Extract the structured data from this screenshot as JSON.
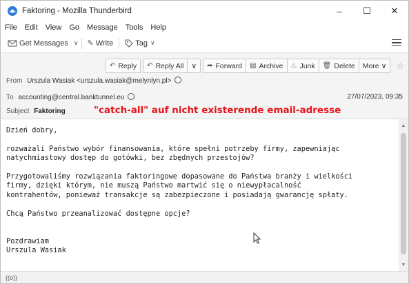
{
  "window": {
    "title": "Faktoring - Mozilla Thunderbird",
    "minimize": "–",
    "maximize": "☐",
    "close": "✕"
  },
  "menu": [
    "File",
    "Edit",
    "View",
    "Go",
    "Message",
    "Tools",
    "Help"
  ],
  "toolbar": {
    "get_messages": "Get Messages",
    "write": "Write",
    "tag": "Tag"
  },
  "actions": {
    "reply": "Reply",
    "reply_all": "Reply All",
    "forward": "Forward",
    "archive": "Archive",
    "junk": "Junk",
    "delete": "Delete",
    "more": "More"
  },
  "header": {
    "from_label": "From",
    "from_value": "Urszula Wasiak <urszula.wasiak@melynlyn.pl>",
    "to_label": "To",
    "to_value": "accounting@central.banktunnel.eu",
    "date": "27/07/2023, 09:35",
    "subject_label": "Subject",
    "subject_value": "Faktoring",
    "annotation": "\"catch-all\" auf nicht existerende email-adresse"
  },
  "body": {
    "text": "Dzień dobry,\n\nrozważali Państwo wybór finansowania, które spełni potrzeby firmy, zapewniając\nnatychmiastowy dostęp do gotówki, bez zbędnych przestojów?\n\nPrzygotowaliśmy rozwiązania faktoringowe dopasowane do Państwa branży i wielkości\nfirmy, dzięki którym, nie muszą Państwo martwić się o niewypłacalność\nkontrahentów, ponieważ transakcje są zabezpieczone i posiadają gwarancję spłaty.\n\nChcą Państwo przeanalizować dostępne opcje?\n\n\nPozdrawiam\nUrszula Wasiak"
  },
  "status": {
    "text": "((o))"
  },
  "colors": {
    "annotation": "#e8141a",
    "header_bg": "#f4f4f4"
  },
  "icons": {
    "app": "thunderbird-icon",
    "get_messages": "envelope-icon",
    "write": "pencil-icon",
    "tag": "tag-icon",
    "reply": "reply-icon",
    "reply_all": "reply-all-icon",
    "forward": "forward-icon",
    "archive": "archive-icon",
    "junk": "junk-icon",
    "delete": "trash-icon",
    "star": "star-icon",
    "menu": "hamburger-icon"
  }
}
